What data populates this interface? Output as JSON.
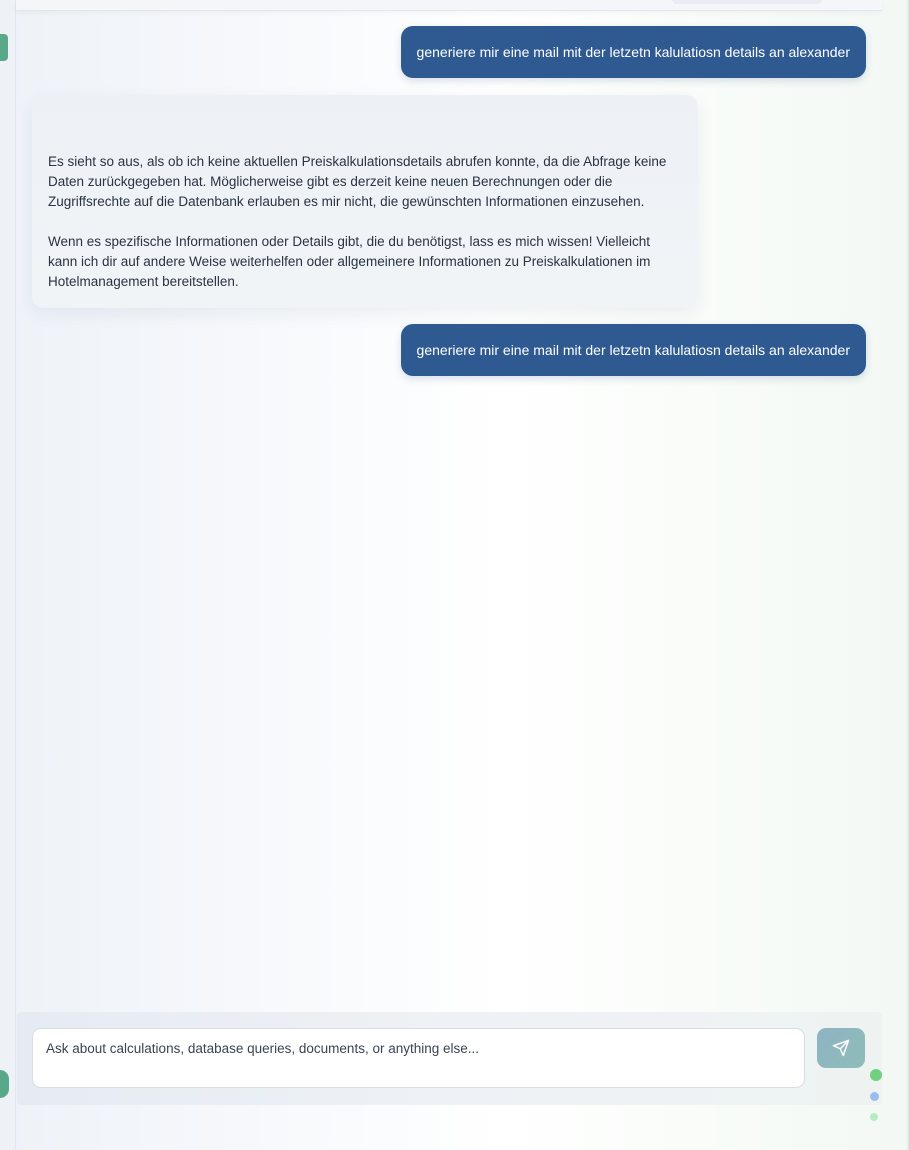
{
  "chat": {
    "messages": [
      {
        "role": "user",
        "text": "generiere mir eine mail mit der letzetn kalulatiosn details an alexander"
      },
      {
        "role": "assistant",
        "paragraphs": [
          "Es sieht so aus, als ob ich keine aktuellen Preiskalkulationsdetails abrufen konnte, da die Abfrage keine Daten zurückgegeben hat. Möglicherweise gibt es derzeit keine neuen Berechnungen oder die Zugriffsrechte auf die Datenbank erlauben es mir nicht, die gewünschten Informationen einzusehen.",
          "Wenn es spezifische Informationen oder Details gibt, die du benötigst, lass es mich wissen! Vielleicht kann ich dir auf andere Weise weiterhelfen oder allgemeinere Informationen zu Preiskalkulationen im Hotelmanagement bereitstellen."
        ]
      },
      {
        "role": "user",
        "text": "generiere mir eine mail mit der letzetn kalulatiosn details an alexander"
      }
    ]
  },
  "composer": {
    "placeholder": "Ask about calculations, database queries, documents, or anything else...",
    "value": "",
    "send_icon": "send-icon"
  },
  "colors": {
    "user_bubble": "#2f5a91",
    "assistant_bubble": "#edf1f6",
    "send_button": "#8fb3c4",
    "accent_green": "#5aa88a"
  }
}
